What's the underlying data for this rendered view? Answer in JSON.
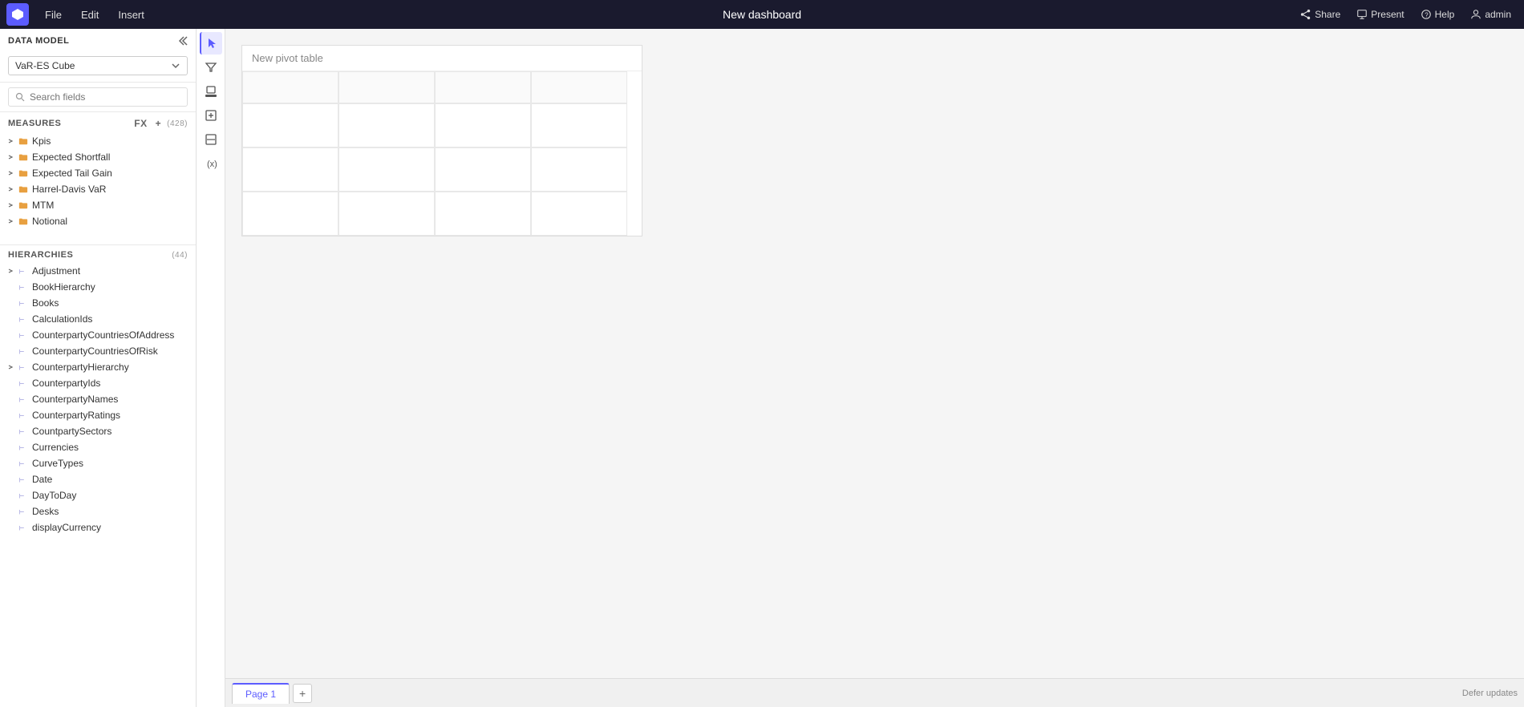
{
  "menuBar": {
    "menuItems": [
      "File",
      "Edit",
      "Insert"
    ],
    "title": "New dashboard",
    "rightItems": [
      {
        "label": "Share",
        "icon": "share-icon"
      },
      {
        "label": "Present",
        "icon": "present-icon"
      },
      {
        "label": "Help",
        "icon": "help-icon"
      },
      {
        "label": "admin",
        "icon": "user-icon"
      }
    ]
  },
  "sidebar": {
    "header": "DATA MODEL",
    "dataModel": "VaR-ES Cube",
    "searchPlaceholder": "Search fields",
    "measures": {
      "label": "MEASURES",
      "fxLabel": "fx",
      "plusLabel": "+",
      "count": "(428)",
      "items": [
        {
          "label": "Kpis",
          "hasExpand": true,
          "iconType": "folder"
        },
        {
          "label": "Expected Shortfall",
          "hasExpand": true,
          "iconType": "folder"
        },
        {
          "label": "Expected Tail Gain",
          "hasExpand": true,
          "iconType": "folder"
        },
        {
          "label": "Harrel-Davis VaR",
          "hasExpand": true,
          "iconType": "folder"
        },
        {
          "label": "MTM",
          "hasExpand": true,
          "iconType": "folder"
        },
        {
          "label": "Notional",
          "hasExpand": true,
          "iconType": "folder"
        }
      ]
    },
    "hierarchies": {
      "label": "HIERARCHIES",
      "count": "(44)",
      "items": [
        {
          "label": "Adjustment",
          "iconType": "hierarchy"
        },
        {
          "label": "BookHierarchy",
          "iconType": "hierarchy"
        },
        {
          "label": "Books",
          "iconType": "hierarchy"
        },
        {
          "label": "CalculationIds",
          "iconType": "hierarchy"
        },
        {
          "label": "CounterpartyCountriesOfAddress",
          "iconType": "hierarchy"
        },
        {
          "label": "CounterpartyCountriesOfRisk",
          "iconType": "hierarchy"
        },
        {
          "label": "CounterpartyHierarchy",
          "iconType": "hierarchy"
        },
        {
          "label": "CounterpartyIds",
          "iconType": "hierarchy"
        },
        {
          "label": "CounterpartyNames",
          "iconType": "hierarchy"
        },
        {
          "label": "CounterpartyRatings",
          "iconType": "hierarchy"
        },
        {
          "label": "CountpartySectors",
          "iconType": "hierarchy"
        },
        {
          "label": "Currencies",
          "iconType": "hierarchy"
        },
        {
          "label": "CurveTypes",
          "iconType": "hierarchy"
        },
        {
          "label": "Date",
          "iconType": "hierarchy"
        },
        {
          "label": "DayToDay",
          "iconType": "hierarchy"
        },
        {
          "label": "Desks",
          "iconType": "hierarchy"
        },
        {
          "label": "displayCurrency",
          "iconType": "hierarchy"
        }
      ]
    }
  },
  "verticalToolbar": {
    "tools": [
      {
        "name": "select-tool",
        "icon": "cursor-icon",
        "active": true
      },
      {
        "name": "filter-tool",
        "icon": "filter-icon",
        "active": false
      },
      {
        "name": "paint-tool",
        "icon": "paint-icon",
        "active": false
      },
      {
        "name": "expand-tool",
        "icon": "expand-icon",
        "active": false
      },
      {
        "name": "shrink-tool",
        "icon": "shrink-icon",
        "active": false
      },
      {
        "name": "variable-tool",
        "icon": "variable-icon",
        "active": false
      }
    ]
  },
  "canvas": {
    "pivotTable": {
      "title": "New pivot table",
      "grid": {
        "rows": 4,
        "cols": 4
      }
    }
  },
  "bottomBar": {
    "tabs": [
      {
        "label": "Page 1",
        "active": true
      }
    ],
    "addTabLabel": "+",
    "deferUpdatesLabel": "Defer updates"
  }
}
